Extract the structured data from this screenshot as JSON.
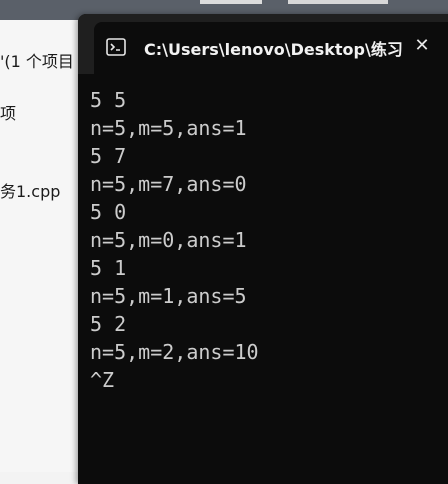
{
  "background_window": {
    "lines": [
      "'(1 个项目",
      "项",
      "务1.cpp"
    ]
  },
  "terminal": {
    "tab_title": "C:\\Users\\lenovo\\Desktop\\练习",
    "close_label": "✕",
    "lines": [
      "5 5",
      "n=5,m=5,ans=1",
      "5 7",
      "n=5,m=7,ans=0",
      "5 0",
      "n=5,m=0,ans=1",
      "5 1",
      "n=5,m=1,ans=5",
      "5 2",
      "n=5,m=2,ans=10",
      "^Z"
    ]
  },
  "colors": {
    "terminal_bg": "#0c0c0c",
    "terminal_fg": "#cccccc",
    "titlebar_bg": "#1f1f1f"
  }
}
